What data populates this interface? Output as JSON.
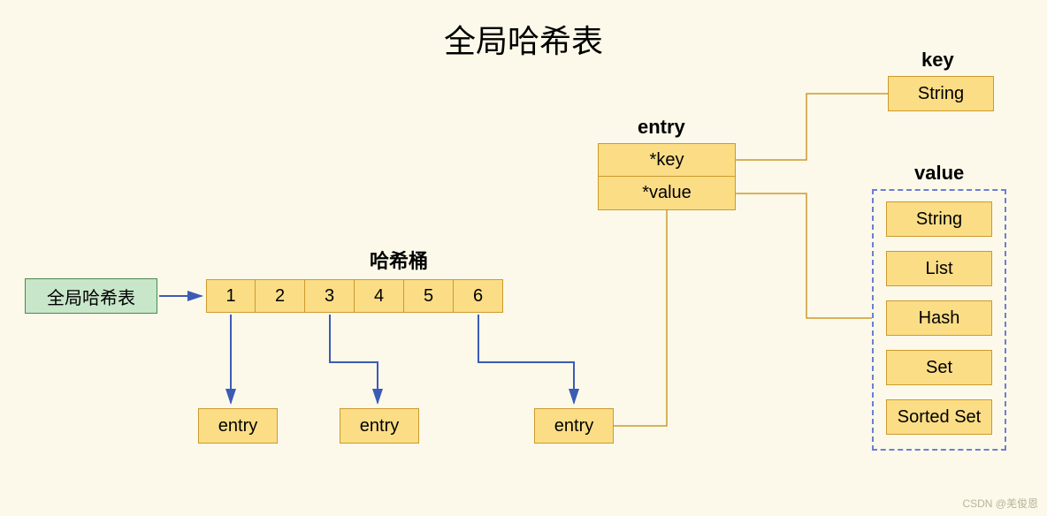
{
  "title": "全局哈希表",
  "globalTable": {
    "label": "全局哈希表"
  },
  "bucket": {
    "label": "哈希桶",
    "cells": [
      "1",
      "2",
      "3",
      "4",
      "5",
      "6"
    ]
  },
  "entries": {
    "e1": "entry",
    "e2": "entry",
    "e3": "entry"
  },
  "entryBox": {
    "label": "entry",
    "key": "*key",
    "value": "*value"
  },
  "key": {
    "label": "key",
    "type": "String"
  },
  "value": {
    "label": "value",
    "types": {
      "t0": "String",
      "t1": "List",
      "t2": "Hash",
      "t3": "Set",
      "t4": "Sorted Set"
    }
  },
  "watermark": "CSDN @羌俊恩"
}
